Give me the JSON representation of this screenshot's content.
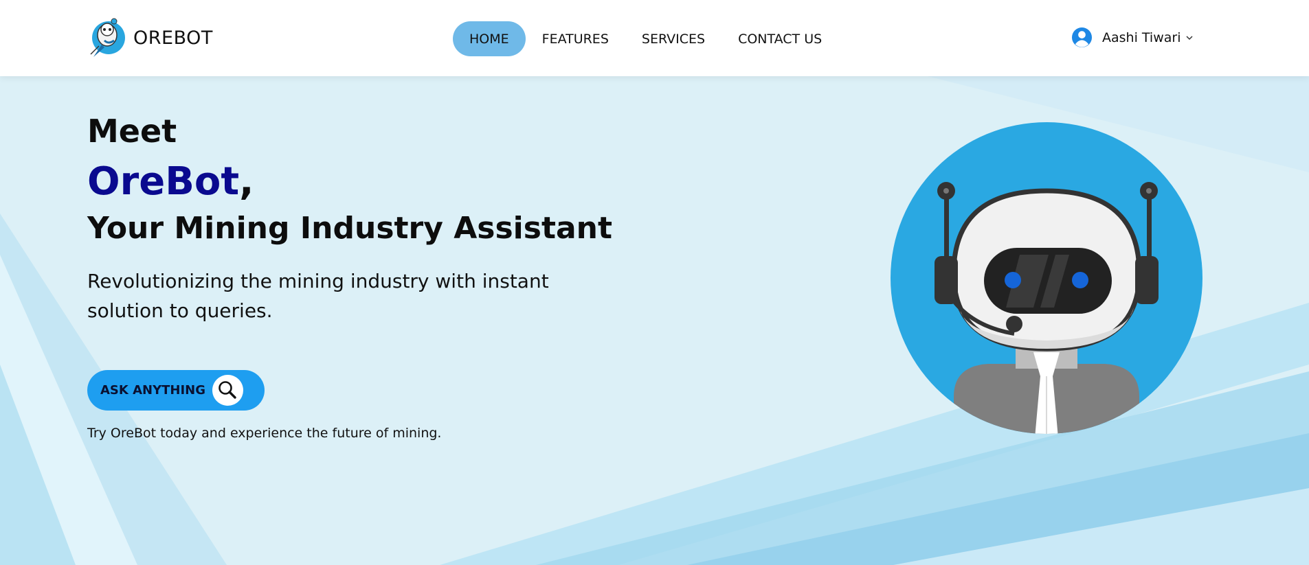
{
  "brand": {
    "name": "OREBOT",
    "logo_icon": "rocket-robot-logo-icon"
  },
  "nav": {
    "items": [
      {
        "label": "HOME",
        "active": true
      },
      {
        "label": "FEATURES",
        "active": false
      },
      {
        "label": "SERVICES",
        "active": false
      },
      {
        "label": "CONTACT US",
        "active": false
      }
    ]
  },
  "user": {
    "name": "Aashi Tiwari",
    "avatar_icon": "user-circle-icon",
    "menu_icon": "chevron-down-icon"
  },
  "hero": {
    "meet": "Meet",
    "brand": "OreBot",
    "brand_suffix": ",",
    "subtitle": "Your Mining Industry Assistant",
    "description": "Revolutionizing the mining industry with instant solution to queries.",
    "cta_label": "ASK ANYTHING",
    "cta_icon": "search-icon",
    "tagline": "Try OreBot today and experience the future of mining."
  },
  "illustration": {
    "icon": "robot-assistant-illustration"
  },
  "colors": {
    "accent": "#1e9ef0",
    "nav_active": "#6fb9e8",
    "brand_blue": "#0a0a8f",
    "robot_circle": "#2aa8e2",
    "hero_bg": "#dcf0f7"
  }
}
